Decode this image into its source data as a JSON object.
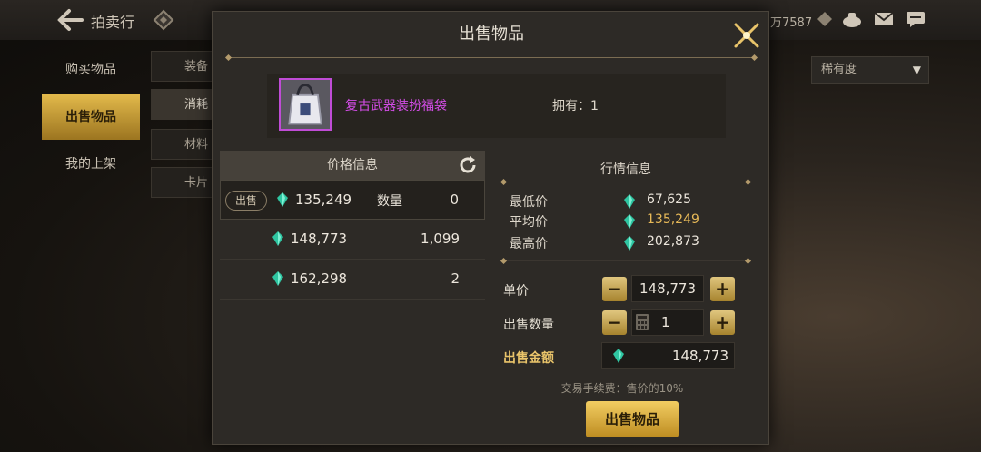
{
  "header": {
    "title": "拍卖行",
    "currency_text": "万7587"
  },
  "sidebar": {
    "items": [
      {
        "label": "购买物品"
      },
      {
        "label": "出售物品"
      },
      {
        "label": "我的上架"
      }
    ]
  },
  "subtabs": [
    "装备",
    "消耗",
    "材料",
    "卡片"
  ],
  "sort": {
    "selected": "稀有度"
  },
  "modal": {
    "title": "出售物品",
    "item": {
      "name": "复古武器装扮福袋",
      "owned_label": "拥有：1"
    },
    "price_info": {
      "title": "价格信息",
      "sell_tag": "出售",
      "qty_label": "数量",
      "rows": [
        {
          "price": "135,249",
          "qty": "0"
        },
        {
          "price": "148,773",
          "qty": "1,099"
        },
        {
          "price": "162,298",
          "qty": "2"
        }
      ]
    },
    "market": {
      "title": "行情信息",
      "rows": [
        {
          "label": "最低价",
          "value": "67,625"
        },
        {
          "label": "平均价",
          "value": "135,249"
        },
        {
          "label": "最高价",
          "value": "202,873"
        }
      ]
    },
    "form": {
      "unit_price_label": "单价",
      "unit_price": "148,773",
      "qty_label": "出售数量",
      "qty": "1",
      "total_label": "出售金额",
      "total": "148,773",
      "minus": "−",
      "plus": "+"
    },
    "fee_text": "交易手续费：售价的10%",
    "sell_button": "出售物品"
  },
  "colors": {
    "accent_gold": "#d9ad3f",
    "item_purple": "#d34de6",
    "gem_green": "#2fc6a2",
    "avg_price": "#e7b958"
  }
}
